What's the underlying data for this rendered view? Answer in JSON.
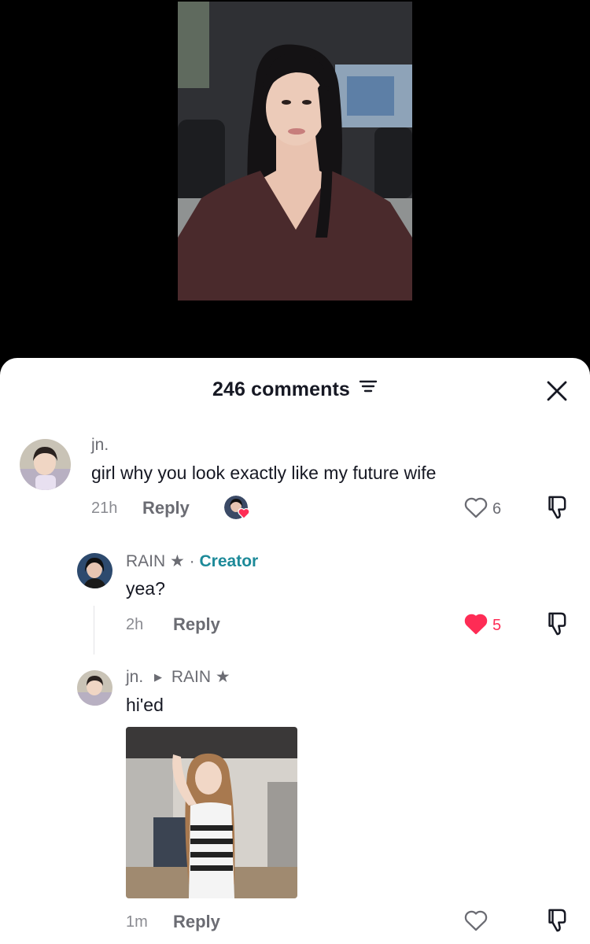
{
  "header": {
    "title": "246 comments"
  },
  "comments": [
    {
      "username": "jn.",
      "text": "girl why you look exactly like my future wife",
      "time": "21h",
      "reply_label": "Reply",
      "likes": "6",
      "liked": false,
      "creator_liked": true
    }
  ],
  "replies": [
    {
      "username": "RAIN ★",
      "separator": " · ",
      "creator_label": "Creator",
      "text": "yea?",
      "time": "2h",
      "reply_label": "Reply",
      "likes": "5",
      "liked": true
    },
    {
      "username": "jn.",
      "reply_to": "RAIN ★",
      "text": "hi'ed",
      "time": "1m",
      "reply_label": "Reply",
      "likes": "",
      "liked": false
    }
  ],
  "icons": {
    "close": "close-icon",
    "filter": "filter-icon",
    "heart": "heart-icon",
    "dislike": "thumbs-down-icon"
  },
  "colors": {
    "liked": "#fe2c55",
    "creator": "#1d8a99",
    "text_primary": "#161823",
    "text_secondary": "#6b6c73"
  }
}
